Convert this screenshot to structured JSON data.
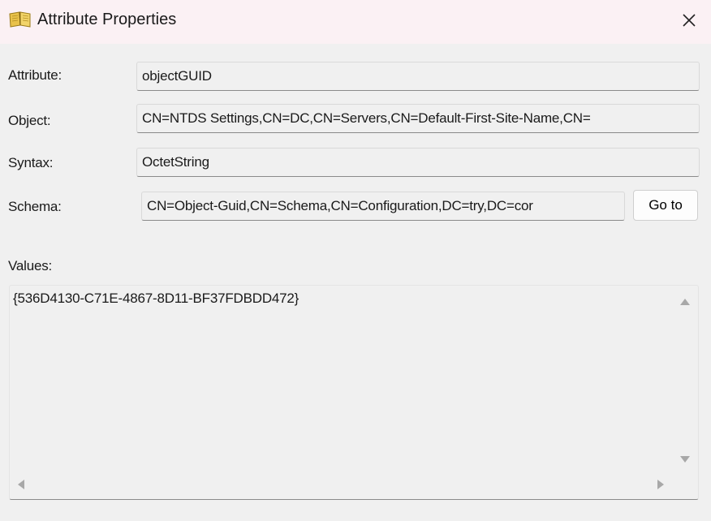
{
  "window": {
    "title": "Attribute Properties",
    "icon": "book-icon",
    "close_label": "×"
  },
  "fields": {
    "attribute": {
      "label": "Attribute:",
      "value": "objectGUID"
    },
    "object": {
      "label": "Object:",
      "value": "CN=NTDS Settings,CN=DC,CN=Servers,CN=Default-First-Site-Name,CN="
    },
    "syntax": {
      "label": "Syntax:",
      "value": "OctetString"
    },
    "schema": {
      "label": "Schema:",
      "value": "CN=Object-Guid,CN=Schema,CN=Configuration,DC=try,DC=cor"
    }
  },
  "goto_label": "Go to",
  "values": {
    "label": "Values:",
    "items": [
      "{536D4130-C71E-4867-8D11-BF37FDBDD472}"
    ]
  }
}
